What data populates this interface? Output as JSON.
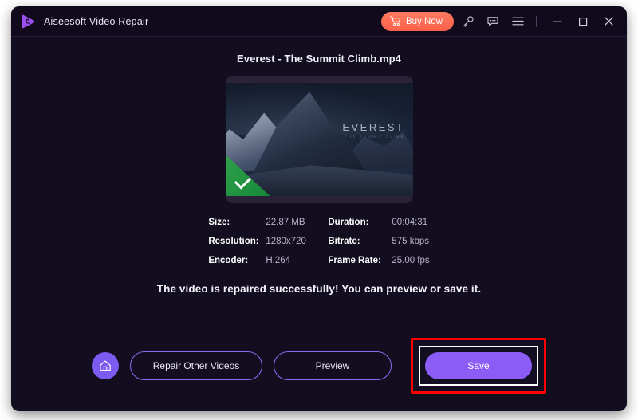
{
  "window": {
    "app_title": "Aiseesoft Video Repair",
    "logo_icon": "play-triangle-logo"
  },
  "titlebar": {
    "buy_now_label": "Buy Now",
    "cart_icon": "shopping-cart-icon",
    "key_icon": "key-icon",
    "feedback_icon": "feedback-chat-icon",
    "menu_icon": "hamburger-menu-icon",
    "minimize_icon": "minimize-icon",
    "maximize_icon": "maximize-icon",
    "close_icon": "close-icon"
  },
  "main": {
    "file_name": "Everest - The Summit Climb.mp4",
    "thumbnail": {
      "overlay_title": "EVEREST",
      "overlay_subtitle": "THE SUMMIT CLIMB",
      "badge_icon": "green-check-badge"
    },
    "metadata": [
      {
        "label": "Size:",
        "value": "22.87 MB",
        "label2": "Duration:",
        "value2": "00:04:31"
      },
      {
        "label": "Resolution:",
        "value": "1280x720",
        "label2": "Bitrate:",
        "value2": "575 kbps"
      },
      {
        "label": "Encoder:",
        "value": "H.264",
        "label2": "Frame Rate:",
        "value2": "25.00 fps"
      }
    ],
    "success_message": "The video is repaired successfully! You can preview or save it."
  },
  "actions": {
    "home_icon": "home-icon",
    "repair_other_label": "Repair Other Videos",
    "preview_label": "Preview",
    "save_label": "Save"
  },
  "colors": {
    "window_bg": "#130d20",
    "titlebar_bg": "#100a1c",
    "accent_purple": "#8b5cf6",
    "buy_now_orange": "#f9604a",
    "success_green": "#17873a",
    "highlight_red": "#ff0000"
  }
}
